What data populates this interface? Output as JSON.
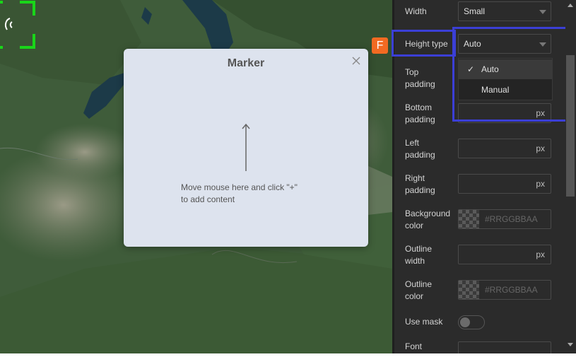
{
  "popup": {
    "title": "Marker",
    "hint": "Move mouse here and click \"+\"\nto add content"
  },
  "badge": {
    "letter": "F",
    "color": "#f26a22"
  },
  "panel": {
    "width": {
      "label": "Width",
      "value": "Small"
    },
    "height_type": {
      "label": "Height type",
      "value": "Auto",
      "options": [
        "Auto",
        "Manual"
      ],
      "selected": "Auto"
    },
    "top_padding": {
      "label": "Top\npadding"
    },
    "bottom_padding": {
      "label": "Bottom\npadding",
      "unit": "px"
    },
    "left_padding": {
      "label": "Left\npadding",
      "unit": "px"
    },
    "right_padding": {
      "label": "Right\npadding",
      "unit": "px"
    },
    "background_color": {
      "label": "Background\ncolor",
      "placeholder": "#RRGGBBAA"
    },
    "outline_width": {
      "label": "Outline\nwidth",
      "unit": "px"
    },
    "outline_color": {
      "label": "Outline\ncolor",
      "placeholder": "#RRGGBBAA"
    },
    "use_mask": {
      "label": "Use mask",
      "enabled": false
    },
    "font": {
      "label": "Font"
    }
  },
  "colors": {
    "highlight": "#3b3fd6",
    "panel_bg": "#2b2b2b",
    "popup_bg": "#dde3ee",
    "target_green": "#19d619"
  }
}
